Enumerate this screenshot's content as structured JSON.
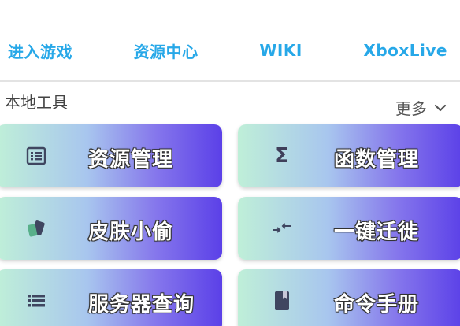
{
  "top_nav": {
    "items": [
      {
        "label": "进入游戏"
      },
      {
        "label": "资源中心"
      },
      {
        "label": "WIKI"
      },
      {
        "label": "XboxLive"
      }
    ]
  },
  "section": {
    "title": "本地工具",
    "more_label": "更多",
    "more_icon": "chevron-down-icon"
  },
  "tools": [
    {
      "label": "资源管理",
      "icon": "list-box-icon"
    },
    {
      "label": "函数管理",
      "icon": "sigma-icon"
    },
    {
      "label": "皮肤小偷",
      "icon": "cards-icon"
    },
    {
      "label": "一键迁徙",
      "icon": "transfer-arrows-icon"
    },
    {
      "label": "服务器查询",
      "icon": "server-list-icon"
    },
    {
      "label": "命令手册",
      "icon": "book-icon"
    }
  ],
  "colors": {
    "nav_link": "#27a8e8",
    "card_gradient_start": "#bfefd8",
    "card_gradient_end": "#5b40e8",
    "card_text": "#ffffff"
  }
}
